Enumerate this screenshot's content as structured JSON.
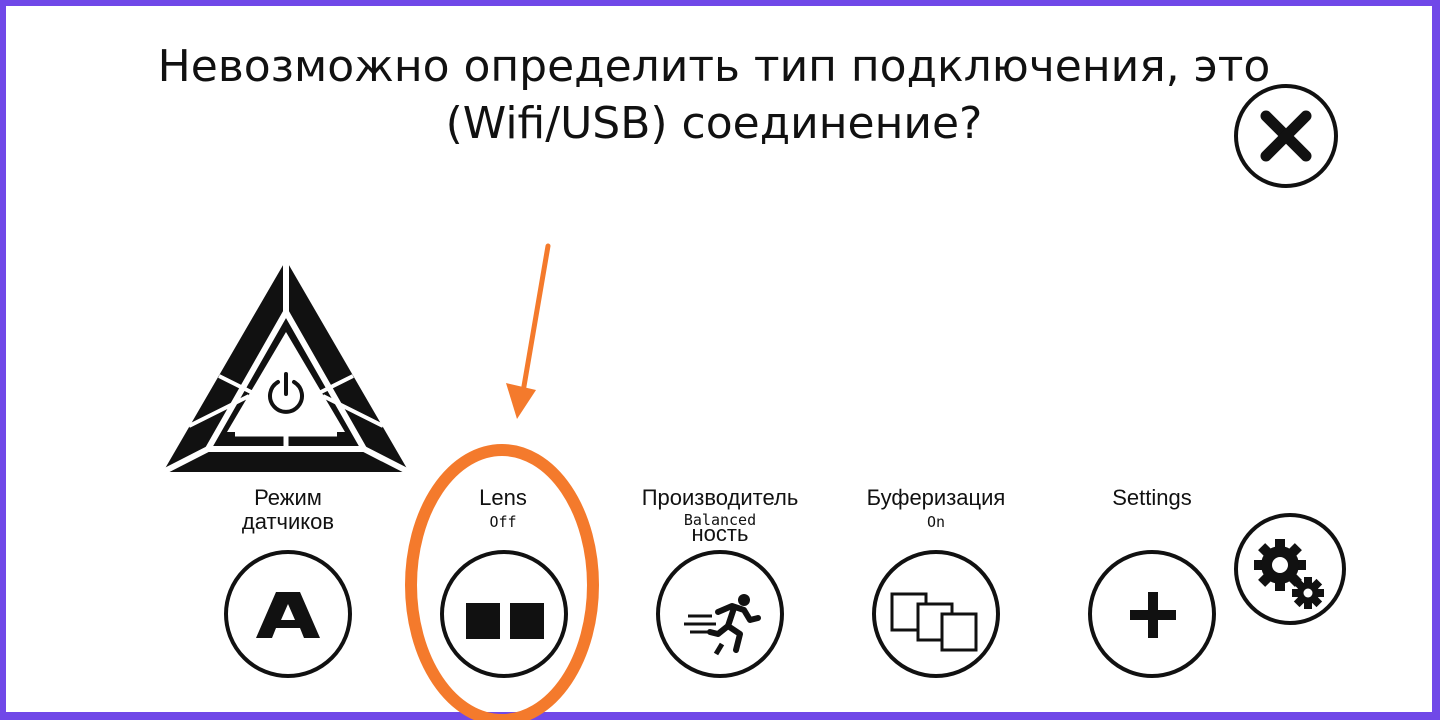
{
  "dialog": {
    "title_line1": "Невозможно определить тип подключения, это",
    "title_line2": "(Wifi/USB) соединение?"
  },
  "icons": {
    "close": "close-icon",
    "logo": "power-triangle-logo",
    "settings": "gear-icon"
  },
  "modes": [
    {
      "label_line1": "Режим",
      "label_line2": "датчиков",
      "value": "",
      "icon": "letter-a-icon"
    },
    {
      "label_line1": "Lens",
      "label_line2": "",
      "value": "Off",
      "icon": "two-squares-icon"
    },
    {
      "label_line1": "Производитель",
      "label_line2": "ность",
      "value": "Balanced",
      "icon": "running-man-icon"
    },
    {
      "label_line1": "Буферизация",
      "label_line2": "",
      "value": "On",
      "icon": "stacked-windows-icon"
    },
    {
      "label_line1": "Settings",
      "label_line2": "",
      "value": "",
      "icon": "plus-icon"
    }
  ],
  "colors": {
    "border": "#7048e8",
    "annotation": "#f47a2c",
    "foreground": "#111111",
    "background": "#ffffff"
  }
}
